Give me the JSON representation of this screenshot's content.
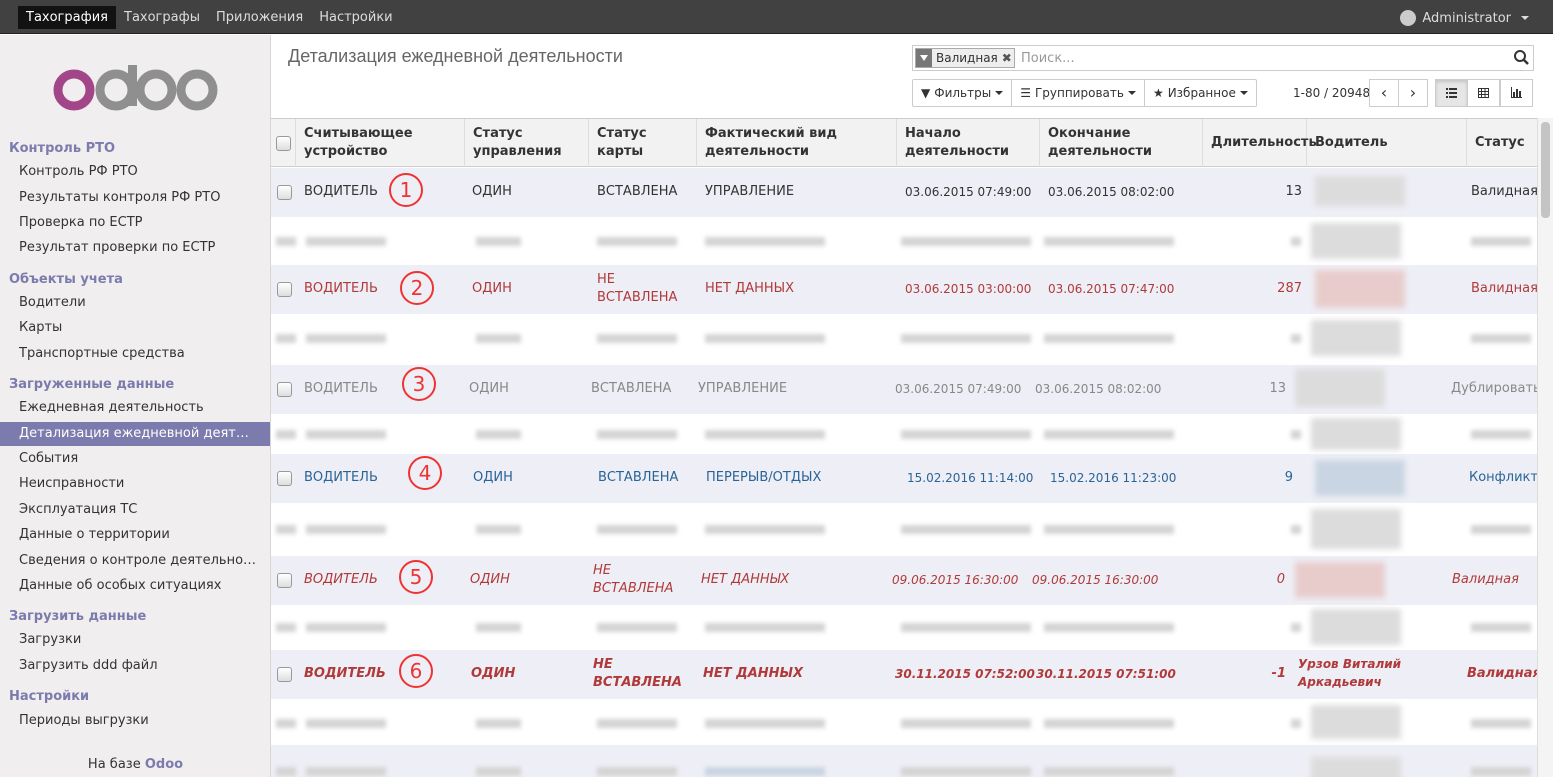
{
  "topbar": {
    "menu": [
      "Тахография",
      "Тахографы",
      "Приложения",
      "Настройки"
    ],
    "user": "Administrator"
  },
  "sidebar": {
    "logo": "odoo",
    "sections": [
      {
        "title": "Контроль РТО",
        "items": [
          "Контроль РФ РТО",
          "Результаты контроля РФ РТО",
          "Проверка по ЕСТР",
          "Результат проверки по ЕСТР"
        ]
      },
      {
        "title": "Объекты учета",
        "items": [
          "Водители",
          "Карты",
          "Транспортные средства"
        ]
      },
      {
        "title": "Загруженные данные",
        "items": [
          "Ежедневная деятельность",
          "Детализация ежедневной деят…",
          "События",
          "Неисправности",
          "Эксплуатация ТС",
          "Данные о территории",
          "Сведения о контроле деятельно…",
          "Данные об особых ситуациях"
        ]
      },
      {
        "title": "Загрузить данные",
        "items": [
          "Загрузки",
          "Загрузить ddd файл"
        ]
      },
      {
        "title": "Настройки",
        "items": [
          "Периоды выгрузки"
        ]
      }
    ],
    "active_item": "Детализация ежедневной деят…",
    "footer_prefix": "На базе",
    "footer_brand": "Odoo"
  },
  "header": {
    "title": "Детализация ежедневной деятельности",
    "search_facet": "Валидная",
    "search_placeholder": "Поиск...",
    "filters_label": "Фильтры",
    "group_label": "Группировать",
    "favorites_label": "Избранное",
    "pager": "1-80 / 20948"
  },
  "table": {
    "columns": [
      "Считывающее устройство",
      "Статус управления",
      "Статус карты",
      "Фактический вид деятельности",
      "Начало деятельности",
      "Окончание деятельности",
      "Длительность",
      "Водитель",
      "Статус"
    ],
    "rows": [
      {
        "n": "1",
        "device": "ВОДИТЕЛЬ",
        "mgmt": "ОДИН",
        "card": "ВСТАВЛЕНА",
        "activity": "УПРАВЛЕНИЕ",
        "start": "03.06.2015 07:49:00",
        "end": "03.06.2015 08:02:00",
        "duration": "13",
        "driver": "",
        "status": "Валидная"
      },
      {
        "n": "2",
        "device": "ВОДИТЕЛЬ",
        "mgmt": "ОДИН",
        "card": "НЕ ВСТАВЛЕНА",
        "activity": "НЕТ ДАННЫХ",
        "start": "03.06.2015 03:00:00",
        "end": "03.06.2015 07:47:00",
        "duration": "287",
        "driver": "",
        "status": "Валидная"
      },
      {
        "n": "3",
        "device": "ВОДИТЕЛЬ",
        "mgmt": "ОДИН",
        "card": "ВСТАВЛЕНА",
        "activity": "УПРАВЛЕНИЕ",
        "start": "03.06.2015 07:49:00",
        "end": "03.06.2015 08:02:00",
        "duration": "13",
        "driver": "",
        "status": "Дублировать"
      },
      {
        "n": "4",
        "device": "ВОДИТЕЛЬ",
        "mgmt": "ОДИН",
        "card": "ВСТАВЛЕНА",
        "activity": "ПЕРЕРЫВ/ОТДЫХ",
        "start": "15.02.2016 11:14:00",
        "end": "15.02.2016 11:23:00",
        "duration": "9",
        "driver": "",
        "status": "Конфликт"
      },
      {
        "n": "5",
        "device": "ВОДИТЕЛЬ",
        "mgmt": "ОДИН",
        "card": "НЕ ВСТАВЛЕНА",
        "activity": "НЕТ ДАННЫХ",
        "start": "09.06.2015 16:30:00",
        "end": "09.06.2015 16:30:00",
        "duration": "0",
        "driver": "",
        "status": "Валидная"
      },
      {
        "n": "6",
        "device": "ВОДИТЕЛЬ",
        "mgmt": "ОДИН",
        "card": "НЕ ВСТАВЛЕНА",
        "activity": "НЕТ ДАННЫХ",
        "start": "30.11.2015 07:52:00",
        "end": "30.11.2015 07:51:00",
        "duration": "-1",
        "driver": "Урзов Виталий Аркадьевич",
        "status": "Валидная"
      }
    ]
  }
}
